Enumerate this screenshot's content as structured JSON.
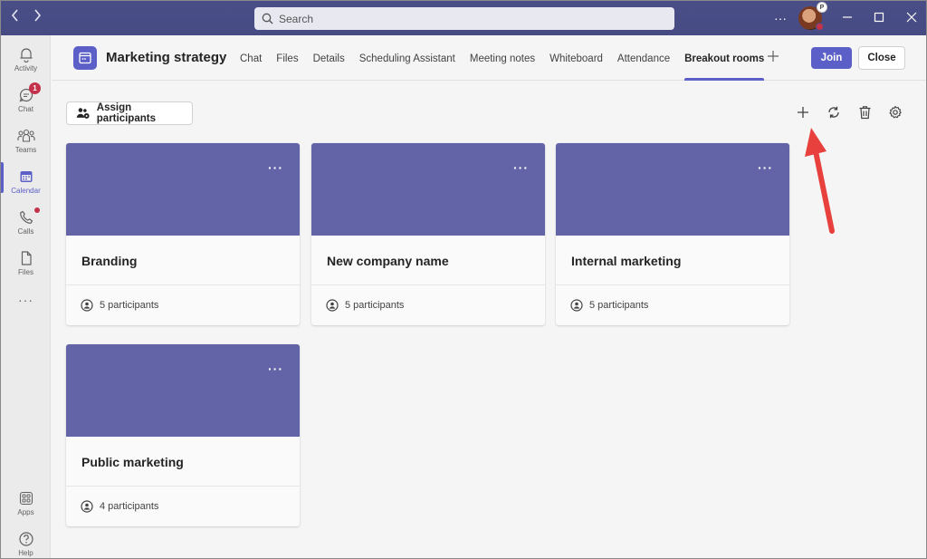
{
  "titlebar": {
    "search_placeholder": "Search",
    "more_label": "···",
    "avatar_badge": "P"
  },
  "rail": {
    "items": [
      {
        "label": "Activity",
        "icon": "bell-icon"
      },
      {
        "label": "Chat",
        "icon": "chat-icon",
        "badge": "1"
      },
      {
        "label": "Teams",
        "icon": "teams-icon"
      },
      {
        "label": "Calendar",
        "icon": "calendar-icon"
      },
      {
        "label": "Calls",
        "icon": "phone-icon"
      },
      {
        "label": "Files",
        "icon": "file-icon"
      },
      {
        "label": "Apps",
        "icon": "apps-icon"
      },
      {
        "label": "Help",
        "icon": "help-icon"
      }
    ],
    "more_label": "···"
  },
  "header": {
    "title": "Marketing strategy",
    "tabs": [
      {
        "label": "Chat"
      },
      {
        "label": "Files"
      },
      {
        "label": "Details"
      },
      {
        "label": "Scheduling Assistant"
      },
      {
        "label": "Meeting notes"
      },
      {
        "label": "Whiteboard"
      },
      {
        "label": "Attendance"
      },
      {
        "label": "Breakout rooms"
      }
    ],
    "join_label": "Join",
    "close_label": "Close"
  },
  "toolbar": {
    "assign_label": "Assign participants"
  },
  "rooms": [
    {
      "name": "Branding",
      "count": "5 participants"
    },
    {
      "name": "New company name",
      "count": "5 participants"
    },
    {
      "name": "Internal marketing",
      "count": "5 participants"
    },
    {
      "name": "Public marketing",
      "count": "4 participants"
    }
  ],
  "colors": {
    "accent": "#5b5fc7",
    "room_header": "#6264a7",
    "badge": "#c4314b",
    "annotation_arrow": "#e8403c"
  }
}
